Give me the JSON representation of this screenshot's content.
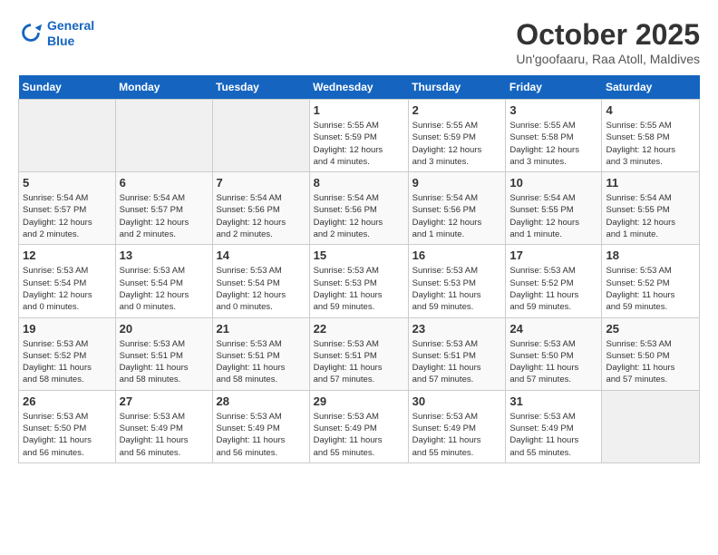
{
  "logo": {
    "line1": "General",
    "line2": "Blue"
  },
  "title": "October 2025",
  "subtitle": "Un'goofaaru, Raa Atoll, Maldives",
  "headers": [
    "Sunday",
    "Monday",
    "Tuesday",
    "Wednesday",
    "Thursday",
    "Friday",
    "Saturday"
  ],
  "weeks": [
    [
      {
        "day": "",
        "info": ""
      },
      {
        "day": "",
        "info": ""
      },
      {
        "day": "",
        "info": ""
      },
      {
        "day": "1",
        "info": "Sunrise: 5:55 AM\nSunset: 5:59 PM\nDaylight: 12 hours\nand 4 minutes."
      },
      {
        "day": "2",
        "info": "Sunrise: 5:55 AM\nSunset: 5:59 PM\nDaylight: 12 hours\nand 3 minutes."
      },
      {
        "day": "3",
        "info": "Sunrise: 5:55 AM\nSunset: 5:58 PM\nDaylight: 12 hours\nand 3 minutes."
      },
      {
        "day": "4",
        "info": "Sunrise: 5:55 AM\nSunset: 5:58 PM\nDaylight: 12 hours\nand 3 minutes."
      }
    ],
    [
      {
        "day": "5",
        "info": "Sunrise: 5:54 AM\nSunset: 5:57 PM\nDaylight: 12 hours\nand 2 minutes."
      },
      {
        "day": "6",
        "info": "Sunrise: 5:54 AM\nSunset: 5:57 PM\nDaylight: 12 hours\nand 2 minutes."
      },
      {
        "day": "7",
        "info": "Sunrise: 5:54 AM\nSunset: 5:56 PM\nDaylight: 12 hours\nand 2 minutes."
      },
      {
        "day": "8",
        "info": "Sunrise: 5:54 AM\nSunset: 5:56 PM\nDaylight: 12 hours\nand 2 minutes."
      },
      {
        "day": "9",
        "info": "Sunrise: 5:54 AM\nSunset: 5:56 PM\nDaylight: 12 hours\nand 1 minute."
      },
      {
        "day": "10",
        "info": "Sunrise: 5:54 AM\nSunset: 5:55 PM\nDaylight: 12 hours\nand 1 minute."
      },
      {
        "day": "11",
        "info": "Sunrise: 5:54 AM\nSunset: 5:55 PM\nDaylight: 12 hours\nand 1 minute."
      }
    ],
    [
      {
        "day": "12",
        "info": "Sunrise: 5:53 AM\nSunset: 5:54 PM\nDaylight: 12 hours\nand 0 minutes."
      },
      {
        "day": "13",
        "info": "Sunrise: 5:53 AM\nSunset: 5:54 PM\nDaylight: 12 hours\nand 0 minutes."
      },
      {
        "day": "14",
        "info": "Sunrise: 5:53 AM\nSunset: 5:54 PM\nDaylight: 12 hours\nand 0 minutes."
      },
      {
        "day": "15",
        "info": "Sunrise: 5:53 AM\nSunset: 5:53 PM\nDaylight: 11 hours\nand 59 minutes."
      },
      {
        "day": "16",
        "info": "Sunrise: 5:53 AM\nSunset: 5:53 PM\nDaylight: 11 hours\nand 59 minutes."
      },
      {
        "day": "17",
        "info": "Sunrise: 5:53 AM\nSunset: 5:52 PM\nDaylight: 11 hours\nand 59 minutes."
      },
      {
        "day": "18",
        "info": "Sunrise: 5:53 AM\nSunset: 5:52 PM\nDaylight: 11 hours\nand 59 minutes."
      }
    ],
    [
      {
        "day": "19",
        "info": "Sunrise: 5:53 AM\nSunset: 5:52 PM\nDaylight: 11 hours\nand 58 minutes."
      },
      {
        "day": "20",
        "info": "Sunrise: 5:53 AM\nSunset: 5:51 PM\nDaylight: 11 hours\nand 58 minutes."
      },
      {
        "day": "21",
        "info": "Sunrise: 5:53 AM\nSunset: 5:51 PM\nDaylight: 11 hours\nand 58 minutes."
      },
      {
        "day": "22",
        "info": "Sunrise: 5:53 AM\nSunset: 5:51 PM\nDaylight: 11 hours\nand 57 minutes."
      },
      {
        "day": "23",
        "info": "Sunrise: 5:53 AM\nSunset: 5:51 PM\nDaylight: 11 hours\nand 57 minutes."
      },
      {
        "day": "24",
        "info": "Sunrise: 5:53 AM\nSunset: 5:50 PM\nDaylight: 11 hours\nand 57 minutes."
      },
      {
        "day": "25",
        "info": "Sunrise: 5:53 AM\nSunset: 5:50 PM\nDaylight: 11 hours\nand 57 minutes."
      }
    ],
    [
      {
        "day": "26",
        "info": "Sunrise: 5:53 AM\nSunset: 5:50 PM\nDaylight: 11 hours\nand 56 minutes."
      },
      {
        "day": "27",
        "info": "Sunrise: 5:53 AM\nSunset: 5:49 PM\nDaylight: 11 hours\nand 56 minutes."
      },
      {
        "day": "28",
        "info": "Sunrise: 5:53 AM\nSunset: 5:49 PM\nDaylight: 11 hours\nand 56 minutes."
      },
      {
        "day": "29",
        "info": "Sunrise: 5:53 AM\nSunset: 5:49 PM\nDaylight: 11 hours\nand 55 minutes."
      },
      {
        "day": "30",
        "info": "Sunrise: 5:53 AM\nSunset: 5:49 PM\nDaylight: 11 hours\nand 55 minutes."
      },
      {
        "day": "31",
        "info": "Sunrise: 5:53 AM\nSunset: 5:49 PM\nDaylight: 11 hours\nand 55 minutes."
      },
      {
        "day": "",
        "info": ""
      }
    ]
  ]
}
